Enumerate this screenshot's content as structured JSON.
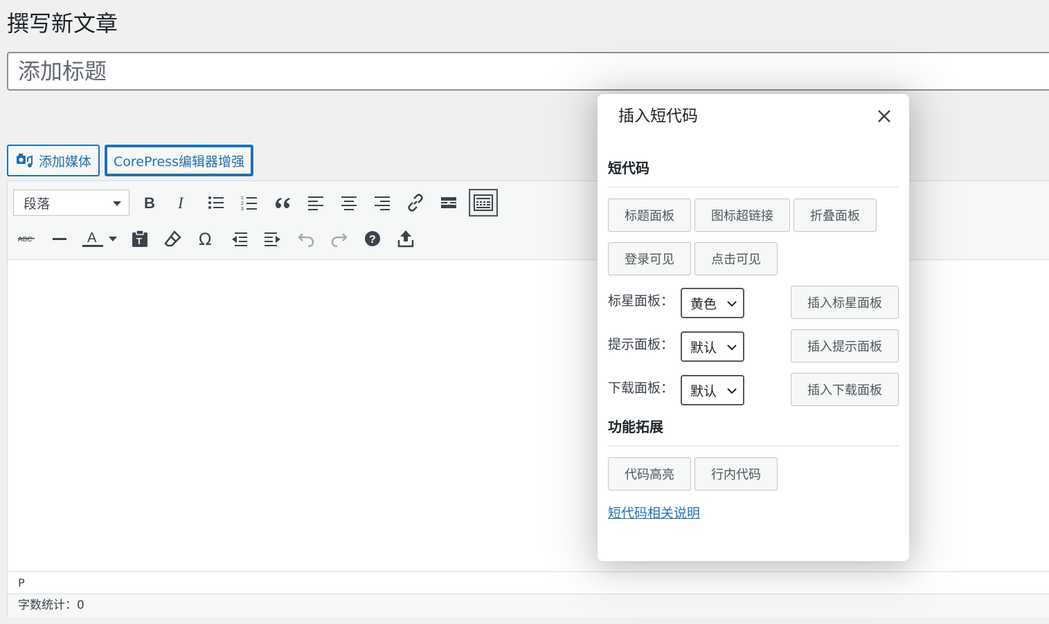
{
  "page": {
    "title": "撰写新文章"
  },
  "post_title": {
    "placeholder": "添加标题"
  },
  "media_buttons": {
    "add_media": "添加媒体",
    "corepress": "CorePress编辑器增强"
  },
  "toolbar": {
    "format_select": "段落",
    "row1_icons": [
      "bold-icon",
      "italic-icon",
      "bullet-list-icon",
      "numbered-list-icon",
      "blockquote-icon",
      "align-left-icon",
      "align-center-icon",
      "align-right-icon",
      "link-icon",
      "read-more-icon",
      "toolbar-toggle-icon"
    ],
    "row2_icons": [
      "strikethrough-icon",
      "horizontal-line-icon",
      "text-color-icon",
      "paste-as-text-icon",
      "clear-formatting-icon",
      "special-character-icon",
      "outdent-icon",
      "indent-icon",
      "undo-icon",
      "redo-icon",
      "help-icon",
      "upload-icon"
    ]
  },
  "editor": {
    "path": "P",
    "word_count": "字数统计：0"
  },
  "modal": {
    "title": "插入短代码",
    "sections": {
      "shortcodes": {
        "title": "短代码",
        "buttons": [
          "标题面板",
          "图标超链接",
          "折叠面板",
          "登录可见",
          "点击可见"
        ]
      },
      "rows": [
        {
          "label": "标星面板：",
          "value": "黄色",
          "button": "插入标星面板"
        },
        {
          "label": "提示面板：",
          "value": "默认",
          "button": "插入提示面板"
        },
        {
          "label": "下载面板：",
          "value": "默认",
          "button": "插入下载面板"
        }
      ],
      "extensions": {
        "title": "功能拓展",
        "buttons": [
          "代码高亮",
          "行内代码"
        ]
      }
    },
    "help_link": "短代码相关说明"
  },
  "colors": {
    "accent": "#2271b1",
    "text": "#1d2327",
    "border": "#c3c4c7"
  }
}
